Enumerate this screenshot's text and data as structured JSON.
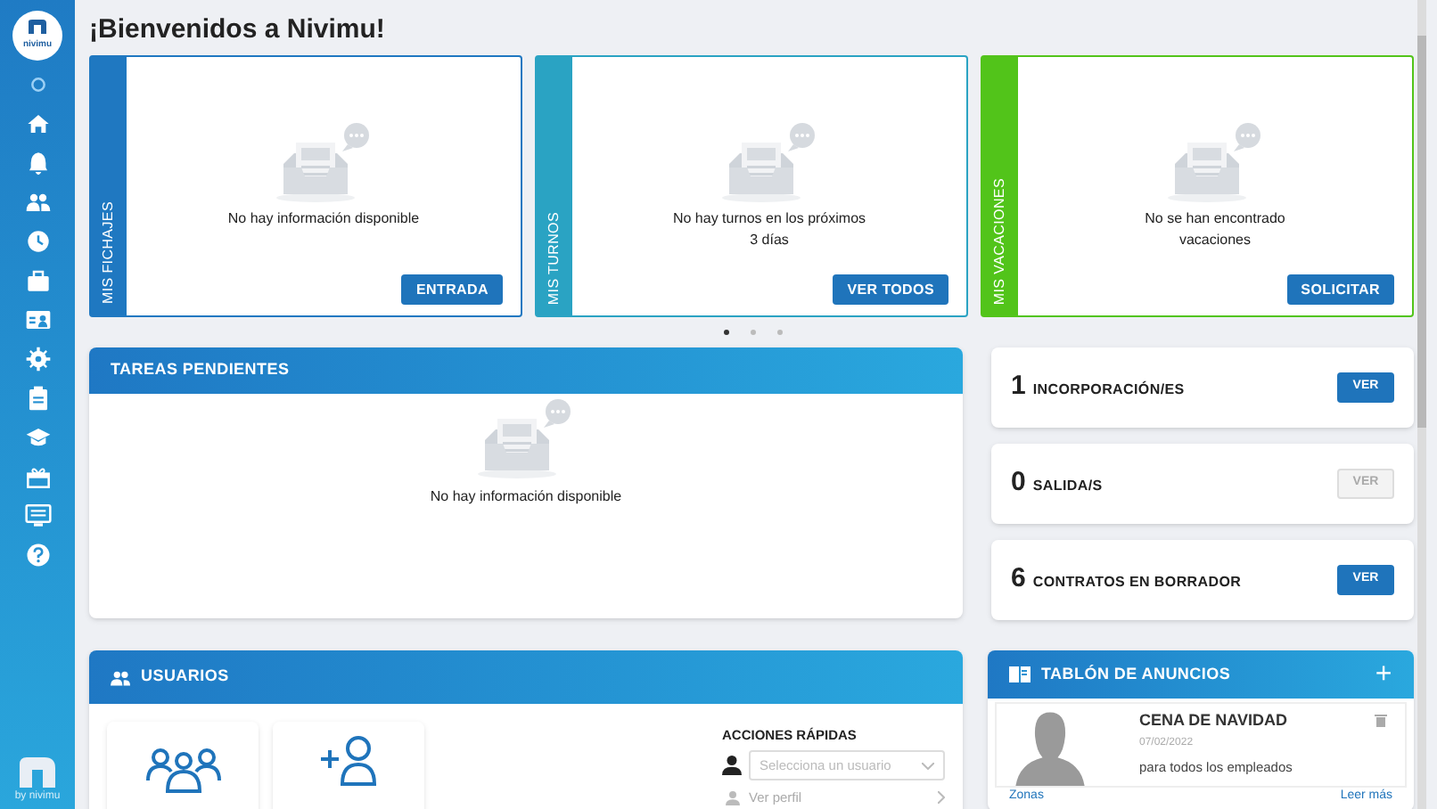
{
  "sidebar": {
    "logo_text": "nivimu",
    "footer_text": "by nivimu"
  },
  "page_title": "¡Bienvenidos a Nivimu!",
  "cards": [
    {
      "tab_label": "MIS FICHAJES",
      "color": "#1f78c1",
      "message": "No hay información disponible",
      "button": "ENTRADA"
    },
    {
      "tab_label": "MIS TURNOS",
      "color": "#2aa3c3",
      "message": "No hay turnos en los próximos 3 días",
      "button": "VER TODOS"
    },
    {
      "tab_label": "MIS VACACIONES",
      "color": "#52c41a",
      "message": "No se han encontrado vacaciones",
      "button": "SOLICITAR"
    }
  ],
  "carousel_dots": [
    {
      "selected": true
    },
    {
      "selected": false
    },
    {
      "selected": false
    }
  ],
  "tasks": {
    "title": "TAREAS PENDIENTES",
    "message": "No hay información disponible"
  },
  "stats": [
    {
      "count": "1",
      "label": "INCORPORACIÓN/ES",
      "button": "VER",
      "disabled": false
    },
    {
      "count": "0",
      "label": "SALIDA/S",
      "button": "VER",
      "disabled": true
    },
    {
      "count": "6",
      "label": "CONTRATOS EN BORRADOR",
      "button": "VER",
      "disabled": false
    }
  ],
  "users": {
    "title": "USUARIOS",
    "quick_actions_title": "ACCIONES RÁPIDAS",
    "select_placeholder": "Selecciona un usuario",
    "profile_link": "Ver perfil"
  },
  "board": {
    "title": "TABLÓN DE ANUNCIOS",
    "add_button": "+",
    "post": {
      "title": "CENA DE NAVIDAD",
      "date": "07/02/2022",
      "text": "para todos los empleados",
      "tag_link": "Zonas",
      "more_link": "Leer más"
    }
  }
}
